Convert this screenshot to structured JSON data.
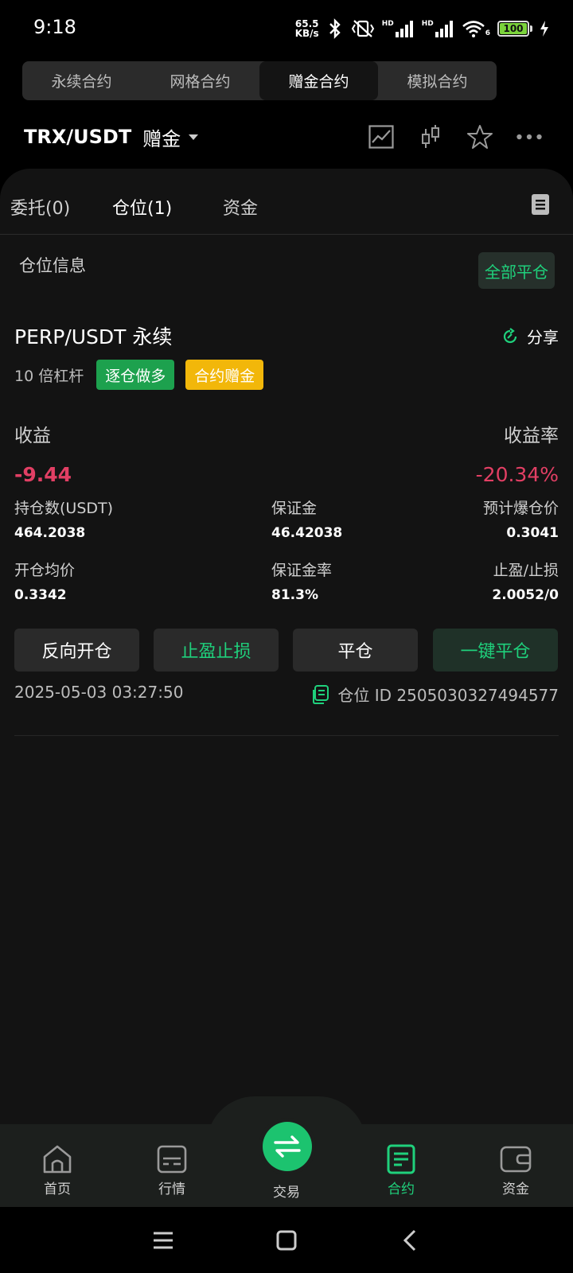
{
  "status": {
    "time": "9:18",
    "net_speed_value": "65.5",
    "net_speed_unit": "KB/s",
    "battery": "100",
    "hd1": "HD",
    "hd2": "HD",
    "wifi_sub": "6"
  },
  "segments": [
    "永续合约",
    "网格合约",
    "赠金合约",
    "模拟合约"
  ],
  "pair": {
    "name": "TRX/USDT",
    "tag": "赠金"
  },
  "tabs": {
    "orders": "委托(0)",
    "positions": "仓位(1)",
    "funds": "资金"
  },
  "section": {
    "title": "仓位信息",
    "close_all": "全部平仓"
  },
  "position": {
    "name": "PERP/USDT 永续",
    "share": "分享",
    "leverage": "10 倍杠杆",
    "badge_mode": "逐仓做多",
    "badge_bonus": "合约赠金",
    "pnl_label": "收益",
    "pnl_value": "-9.44",
    "pnl_rate_label": "收益率",
    "pnl_rate_value": "-20.34%",
    "stats": {
      "size_label": "持仓数(USDT)",
      "size_value": "464.2038",
      "margin_label": "保证金",
      "margin_value": "46.42038",
      "liq_label": "预计爆仓价",
      "liq_value": "0.3041",
      "entry_label": "开仓均价",
      "entry_value": "0.3342",
      "margin_rate_label": "保证金率",
      "margin_rate_value": "81.3%",
      "tpsl_label": "止盈/止损",
      "tpsl_value": "2.0052/0"
    },
    "actions": {
      "reverse": "反向开仓",
      "tpsl": "止盈止损",
      "close": "平仓",
      "quick_close": "一键平仓"
    },
    "open_time": "2025-05-03 03:27:50",
    "position_id": "仓位 ID 2505030327494577"
  },
  "nav": {
    "home": "首页",
    "market": "行情",
    "trade": "交易",
    "contract": "合约",
    "assets": "资金"
  },
  "colors": {
    "accent_green": "#1fd17c",
    "loss_red": "#e23f64",
    "badge_green": "#1da14e",
    "badge_yellow": "#f2b70a"
  }
}
